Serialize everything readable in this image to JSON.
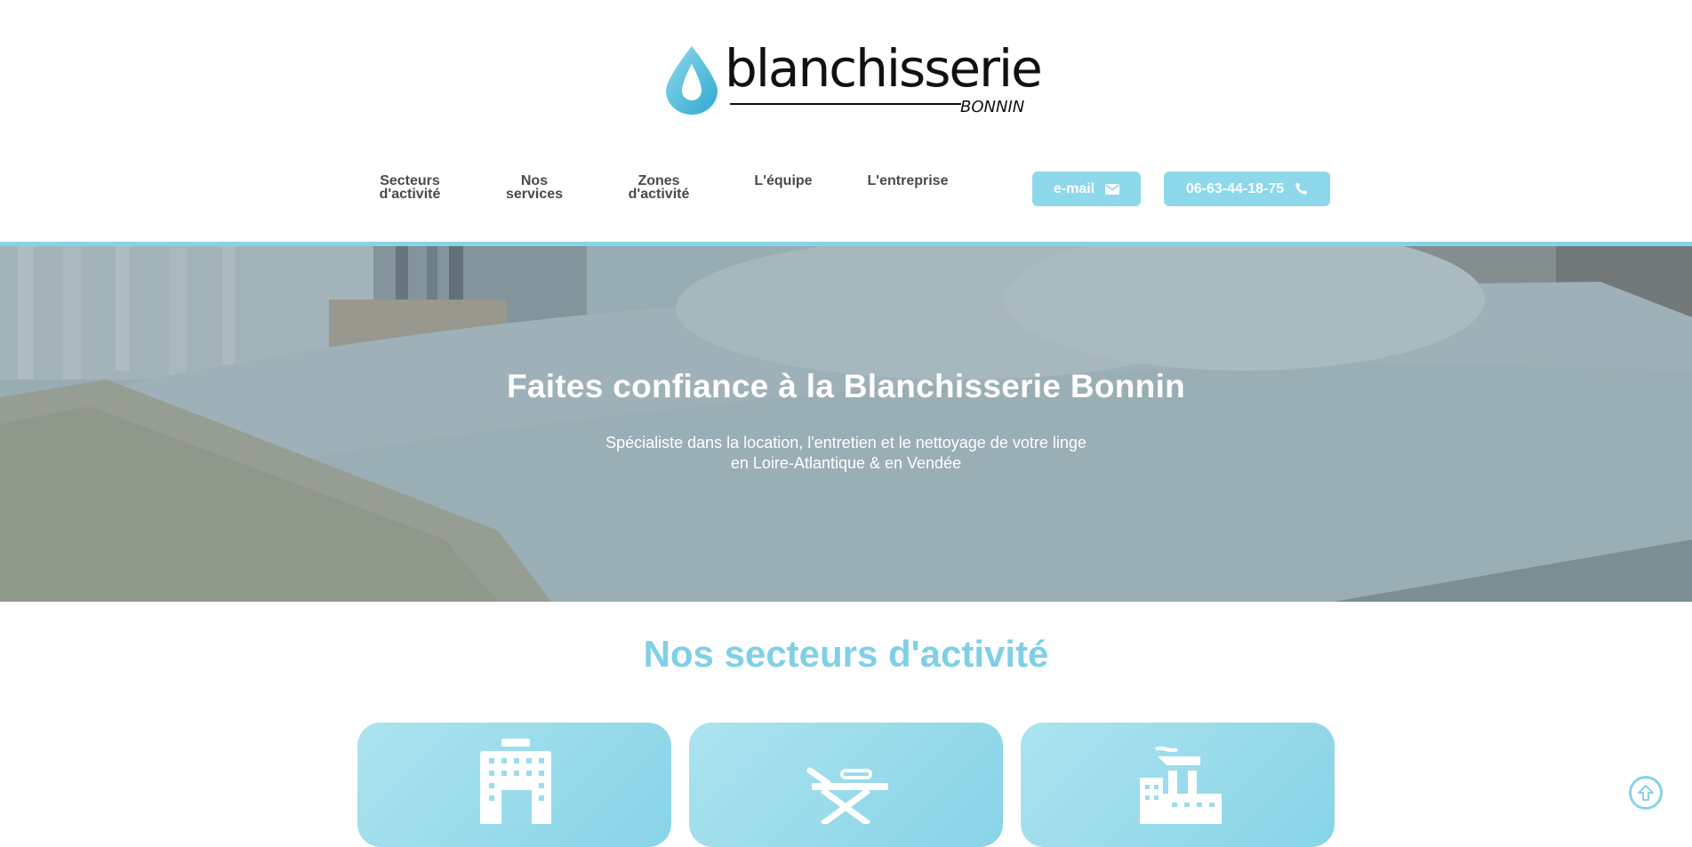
{
  "brand": {
    "name": "blanchisserie",
    "subname": "BONNIN",
    "primary_color": "#86d3e8",
    "logo_icon": "water-drop-icon"
  },
  "nav": {
    "items": [
      {
        "line1": "Secteurs",
        "line2": "d'activité"
      },
      {
        "line1": "Nos",
        "line2": "services"
      },
      {
        "line1": "Zones",
        "line2": "d'activité"
      },
      {
        "line1": "L'équipe",
        "line2": ""
      },
      {
        "line1": "L'entreprise",
        "line2": ""
      }
    ]
  },
  "contact": {
    "email_label": "e-mail",
    "email_icon": "envelope-icon",
    "phone_label": "06-63-44-18-75",
    "phone_icon": "phone-icon"
  },
  "hero": {
    "title": "Faites confiance à la Blanchisserie Bonnin",
    "subtitle_line1": "Spécialiste dans la location, l'entretien et le nettoyage de votre linge",
    "subtitle_line2": "en Loire-Atlantique & en Vendée"
  },
  "sectors": {
    "title": "Nos secteurs d'activité",
    "cards": [
      {
        "icon": "hotel-building-icon"
      },
      {
        "icon": "medical-stretcher-icon"
      },
      {
        "icon": "factory-icon"
      }
    ]
  },
  "scroll_top": {
    "icon": "arrow-up-circle-icon"
  }
}
